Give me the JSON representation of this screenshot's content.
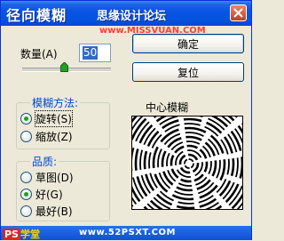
{
  "window": {
    "title": "径向模糊",
    "watermark_cn": "思缘设计论坛",
    "watermark_url": "www.MISSVUAN.COM"
  },
  "amount": {
    "label": "数量(A)",
    "value": "50",
    "slider_fraction": 0.5
  },
  "buttons": {
    "ok": "确定",
    "reset": "复位"
  },
  "blur_method": {
    "title": "模糊方法:",
    "options": [
      {
        "label": "旋转(S)",
        "checked": true
      },
      {
        "label": "缩放(Z)",
        "checked": false
      }
    ]
  },
  "quality": {
    "title": "品质:",
    "options": [
      {
        "label": "草图(D)",
        "checked": false
      },
      {
        "label": "好(G)",
        "checked": true
      },
      {
        "label": "最好(B)",
        "checked": false
      }
    ]
  },
  "preview": {
    "label": "中心模糊"
  },
  "footer": {
    "logo_ps": "PS",
    "logo_text": "学堂",
    "url": "www.52PSXT.COM"
  },
  "colors": {
    "titlebar": "#0553e1",
    "group_title": "#0046d5",
    "radio_checked": "#21a121",
    "selection": "#316ac5"
  }
}
